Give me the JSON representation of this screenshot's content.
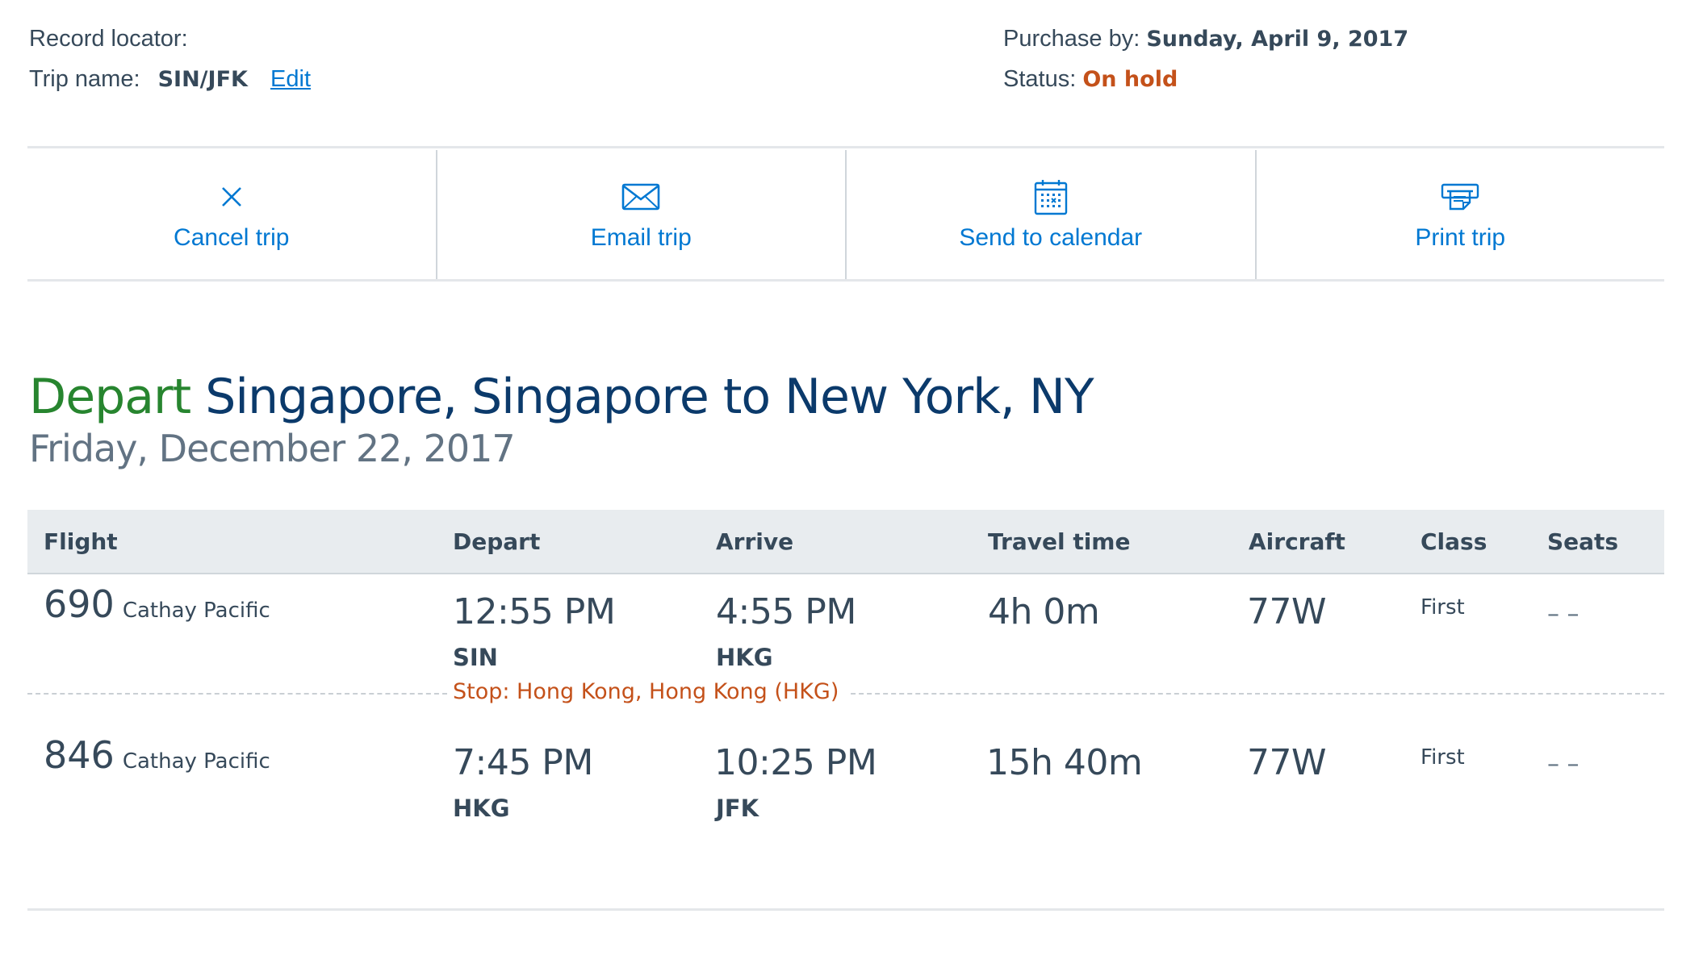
{
  "header": {
    "record_locator_label": "Record locator:",
    "trip_name_label": "Trip name:",
    "trip_name_value": "SIN/JFK",
    "edit_label": "Edit",
    "purchase_by_label": "Purchase by:",
    "purchase_by_value": "Sunday, April 9, 2017",
    "status_label": "Status:",
    "status_value": "On hold"
  },
  "actions": {
    "cancel": {
      "label": "Cancel trip",
      "icon": "close-icon"
    },
    "email": {
      "label": "Email trip",
      "icon": "envelope-icon"
    },
    "calendar": {
      "label": "Send to calendar",
      "icon": "calendar-icon"
    },
    "print": {
      "label": "Print trip",
      "icon": "printer-icon"
    }
  },
  "itinerary": {
    "depart_word": "Depart",
    "route": "Singapore, Singapore to New York, NY",
    "date": "Friday, December 22, 2017"
  },
  "table": {
    "headers": {
      "flight": "Flight",
      "depart": "Depart",
      "arrive": "Arrive",
      "travel_time": "Travel time",
      "aircraft": "Aircraft",
      "class": "Class",
      "seats": "Seats"
    },
    "rows": [
      {
        "flight_number": "690",
        "carrier": "Cathay Pacific",
        "depart_time": "12:55 PM",
        "depart_code": "SIN",
        "arrive_time": "4:55 PM",
        "arrive_code": "HKG",
        "travel_time": "4h 0m",
        "aircraft": "77W",
        "class": "First",
        "seats": "– –"
      },
      {
        "flight_number": "846",
        "carrier": "Cathay Pacific",
        "depart_time": "7:45 PM",
        "depart_code": "HKG",
        "arrive_time": "10:25 PM",
        "arrive_code": "JFK",
        "travel_time": "15h 40m",
        "aircraft": "77W",
        "class": "First",
        "seats": "– –"
      }
    ],
    "stop_text": "Stop: Hong Kong, Hong Kong (HKG)"
  },
  "colors": {
    "link": "#0078d2",
    "status_orange": "#c4511a",
    "depart_green": "#27852f",
    "heading_navy": "#0b3a6b",
    "text": "#36495a"
  }
}
